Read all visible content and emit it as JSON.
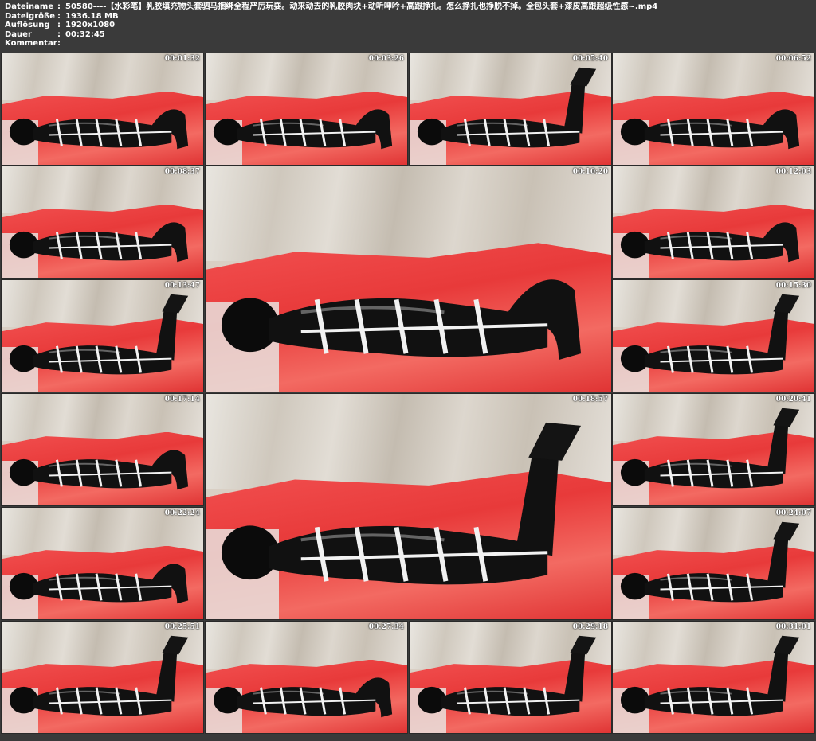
{
  "header": {
    "rows": [
      {
        "key": "Dateiname",
        "value": "50580----【水彩笔】乳胶填充物头套驷马捆绑全程严厉玩耍。动来动去的乳胶肉块+动听呻吟+高跟挣扎。怎么挣扎也挣脱不掉。全包头套+漆皮高跟超级性感~.mp4"
      },
      {
        "key": "Dateigröße",
        "value": "1936.18 MB"
      },
      {
        "key": "Auflösung",
        "value": "1920x1080"
      },
      {
        "key": "Dauer",
        "value": "00:32:45"
      },
      {
        "key": "Kommentar",
        "value": ""
      }
    ]
  },
  "thumbnails": [
    {
      "timestamp": "00:01:32",
      "pose": "lying"
    },
    {
      "timestamp": "00:03:26",
      "pose": "lying"
    },
    {
      "timestamp": "00:05:40",
      "pose": "legs-up"
    },
    {
      "timestamp": "00:06:52",
      "pose": "lying"
    },
    {
      "timestamp": "00:08:37",
      "pose": "lying"
    },
    {
      "timestamp": "00:10:20",
      "pose": "lying"
    },
    {
      "timestamp": "00:12:03",
      "pose": "lying"
    },
    {
      "timestamp": "00:13:47",
      "pose": "legs-up"
    },
    {
      "timestamp": "00:15:30",
      "pose": "legs-up"
    },
    {
      "timestamp": "00:17:14",
      "pose": "lying"
    },
    {
      "timestamp": "00:18:57",
      "pose": "legs-up"
    },
    {
      "timestamp": "00:20:41",
      "pose": "legs-up"
    },
    {
      "timestamp": "00:22:24",
      "pose": "lying"
    },
    {
      "timestamp": "00:24:07",
      "pose": "legs-up"
    },
    {
      "timestamp": "00:25:51",
      "pose": "legs-up"
    },
    {
      "timestamp": "00:27:34",
      "pose": "lying"
    },
    {
      "timestamp": "00:29:18",
      "pose": "legs-up"
    },
    {
      "timestamp": "00:31:01",
      "pose": "legs-up"
    }
  ]
}
